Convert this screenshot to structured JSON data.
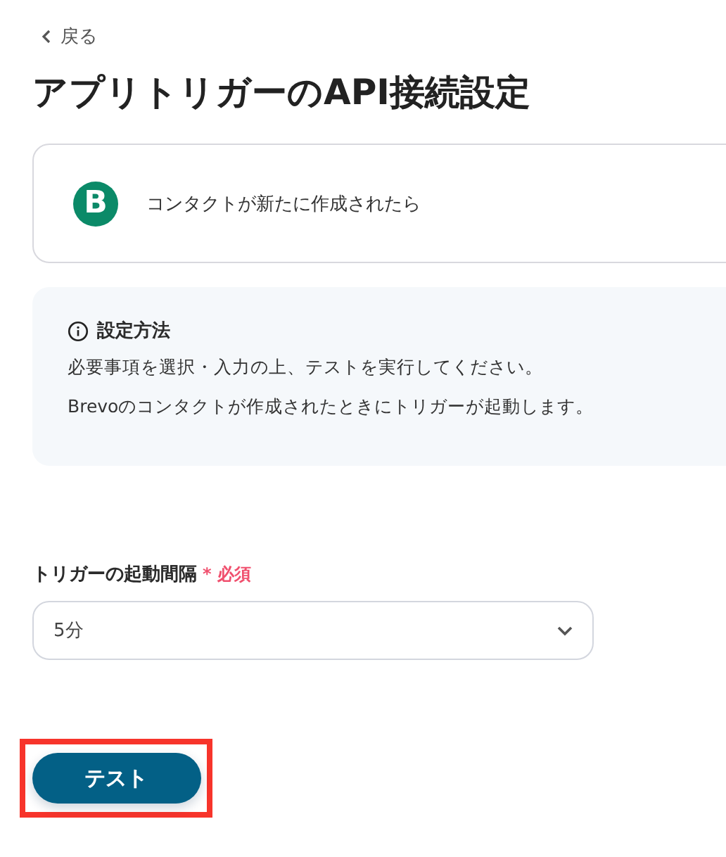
{
  "back_link": {
    "label": "戻る"
  },
  "title": "アプリトリガーのAPI接続設定",
  "app_card": {
    "app_initial": "B",
    "event": "コンタクトが新たに作成されたら"
  },
  "info": {
    "heading": "設定方法",
    "lines": [
      "必要事項を選択・入力の上、テストを実行してください。",
      "Brevoのコンタクトが作成されたときにトリガーが起動します。"
    ]
  },
  "field": {
    "label": "トリガーの起動間隔",
    "required_mark": "*",
    "required_label": "必須",
    "value": "5分"
  },
  "test_button": {
    "label": "テスト",
    "highlighted": true
  }
}
